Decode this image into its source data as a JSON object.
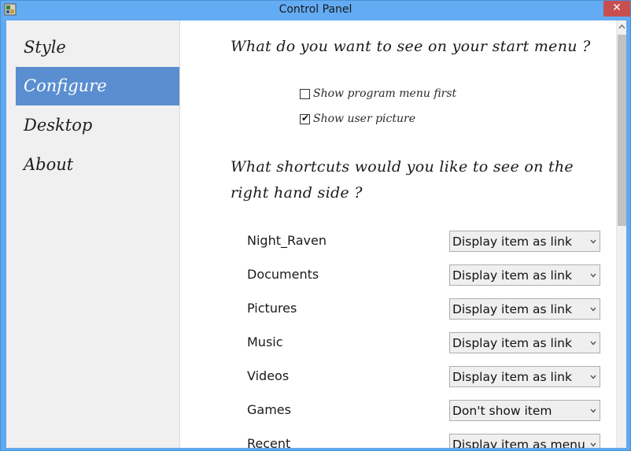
{
  "window": {
    "title": "Control Panel",
    "close_symbol": "✕"
  },
  "sidebar": {
    "items": [
      {
        "label": "Style",
        "active": false
      },
      {
        "label": "Configure",
        "active": true
      },
      {
        "label": "Desktop",
        "active": false
      },
      {
        "label": "About",
        "active": false
      }
    ]
  },
  "start_menu": {
    "heading": "What do you want to see on your start menu ?",
    "options": [
      {
        "label": "Show program menu first",
        "checked": false
      },
      {
        "label": "Show user picture",
        "checked": true
      }
    ]
  },
  "shortcuts": {
    "heading_line1": "What shortcuts would you like to see on the",
    "heading_line2": "right hand side ?",
    "items": [
      {
        "label": "Night_Raven",
        "value": "Display item as link"
      },
      {
        "label": "Documents",
        "value": "Display item as link"
      },
      {
        "label": "Pictures",
        "value": "Display item as link"
      },
      {
        "label": "Music",
        "value": "Display item as link"
      },
      {
        "label": "Videos",
        "value": "Display item as link"
      },
      {
        "label": "Games",
        "value": "Don't show item"
      },
      {
        "label": "Recent",
        "value": "Display item as menu"
      }
    ]
  },
  "icons": {
    "app": "control-panel-icon",
    "dropdown": "chevron-down-icon",
    "check": "checkmark-icon"
  },
  "colors": {
    "titlebar": "#63abf3",
    "active_nav": "#5a8ed0",
    "close": "#c74f4f"
  }
}
